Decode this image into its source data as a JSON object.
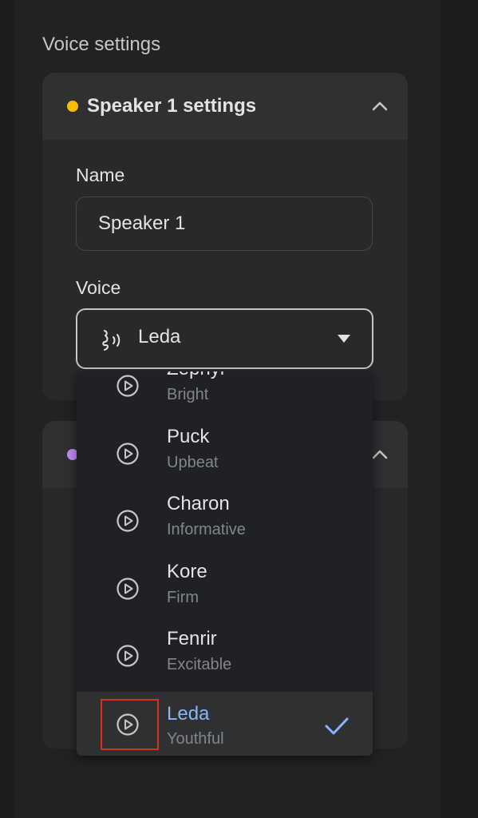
{
  "section_title": "Voice settings",
  "speaker1": {
    "title": "Speaker 1 settings",
    "dot_color": "#fbbc04",
    "name_label": "Name",
    "name_value": "Speaker 1",
    "voice_label": "Voice",
    "voice_value": "Leda"
  },
  "speaker2": {
    "dot_color": "#c58af9"
  },
  "dropdown": {
    "options": [
      {
        "name": "Zephyr",
        "desc": "Bright"
      },
      {
        "name": "Puck",
        "desc": "Upbeat"
      },
      {
        "name": "Charon",
        "desc": "Informative"
      },
      {
        "name": "Kore",
        "desc": "Firm"
      },
      {
        "name": "Fenrir",
        "desc": "Excitable"
      },
      {
        "name": "Leda",
        "desc": "Youthful",
        "selected": true
      }
    ]
  },
  "colors": {
    "accent": "#8ab4f8",
    "highlight": "#d93025"
  },
  "icons": {
    "play": "play-circle-icon",
    "check": "check-icon",
    "chevron": "chevron-up-icon",
    "voice": "voice-wave-icon",
    "caret": "caret-down-icon"
  }
}
